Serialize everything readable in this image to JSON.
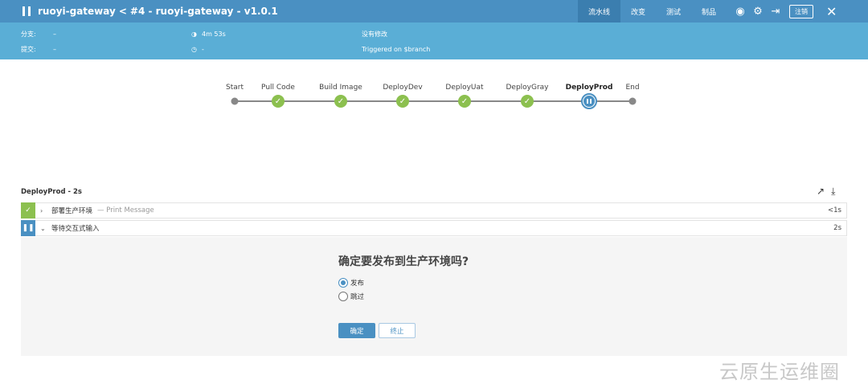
{
  "header": {
    "job_name": "ruoyi-gateway",
    "separator": "<",
    "run_title": "#4 - ruoyi-gateway - v1.0.1",
    "tabs": [
      "流水线",
      "改变",
      "测试",
      "制品"
    ],
    "active_tab": "流水线",
    "logout_label": "注销"
  },
  "info": {
    "branch_label": "分支:",
    "branch_value": "–",
    "commit_label": "提交:",
    "commit_value": "–",
    "duration": "4m 53s",
    "time_value": "-",
    "changes": "没有修改",
    "trigger": "Triggered on $branch"
  },
  "pipeline": {
    "stages": [
      {
        "label": "Start",
        "state": "plain"
      },
      {
        "label": "Pull Code",
        "state": "success"
      },
      {
        "label": "Build Image",
        "state": "success"
      },
      {
        "label": "DeployDev",
        "state": "success"
      },
      {
        "label": "DeployUat",
        "state": "success"
      },
      {
        "label": "DeployGray",
        "state": "success"
      },
      {
        "label": "DeployProd",
        "state": "paused"
      },
      {
        "label": "End",
        "state": "plain"
      }
    ]
  },
  "step_panel": {
    "title": "DeployProd - 2s",
    "steps": [
      {
        "name": "部署生产环境",
        "desc": "— Print Message",
        "duration": "<1s",
        "state": "success"
      },
      {
        "name": "等待交互式输入",
        "desc": "",
        "duration": "2s",
        "state": "paused"
      }
    ]
  },
  "input": {
    "question": "确定要发布到生产环境吗?",
    "options": [
      "发布",
      "跳过"
    ],
    "selected": "发布",
    "confirm_label": "确定",
    "abort_label": "终止"
  },
  "watermark": "云原生运维圈",
  "colors": {
    "accent": "#4a90c2",
    "success": "#8cc04f",
    "info_bar": "#5aaed6"
  }
}
